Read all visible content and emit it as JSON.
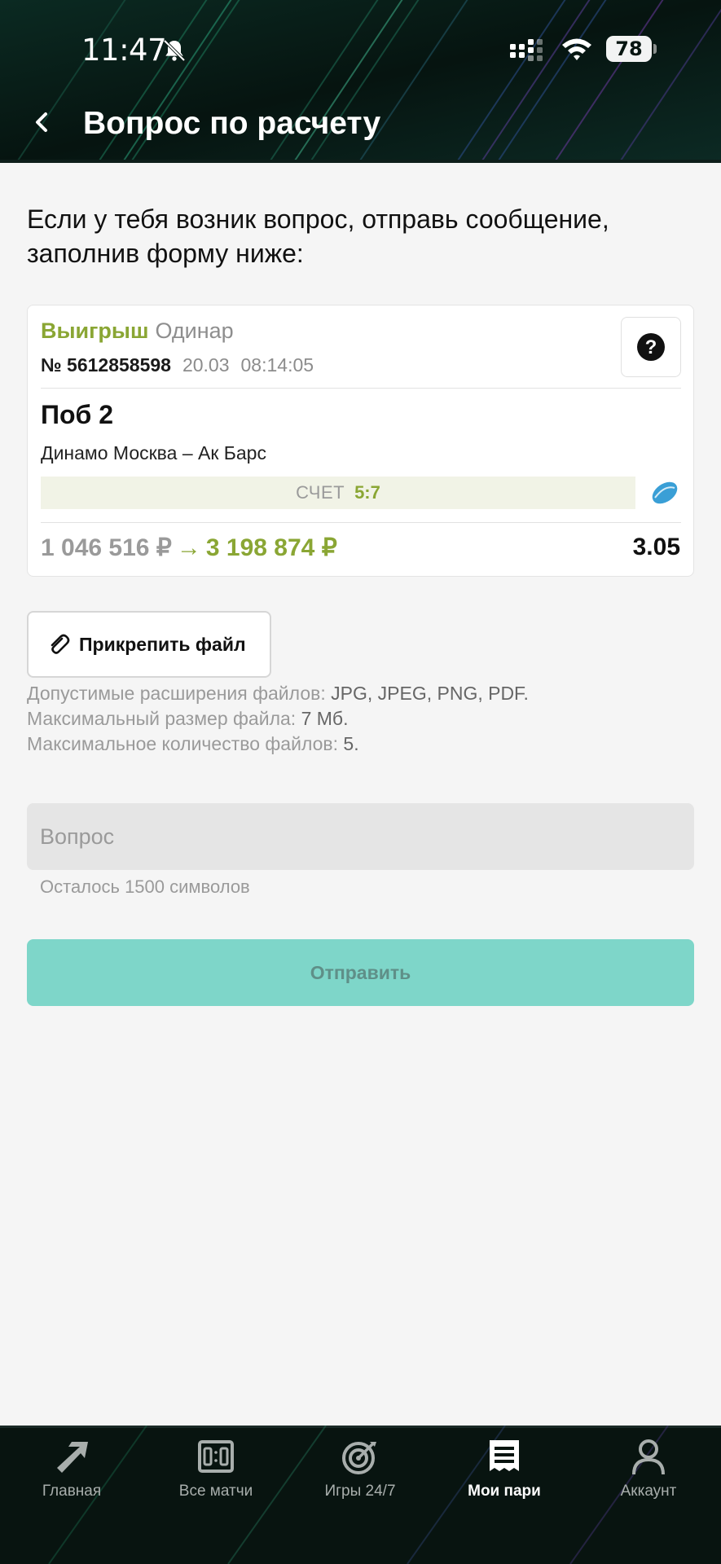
{
  "status_bar": {
    "time": "11:47",
    "battery": "78"
  },
  "header": {
    "title": "Вопрос по расчету"
  },
  "intro": "Если у тебя возник вопрос, отправь сообщение, заполнив форму ниже:",
  "bet": {
    "status": "Выигрыш",
    "type": "Одинар",
    "number": "№ 5612858598",
    "date": "20.03",
    "time": "08:14:05",
    "outcome": "Поб 2",
    "match": "Динамо Москва – Ак Барс",
    "score_label": "СЧЕТ",
    "score": "5:7",
    "stake": "1 046 516 ₽",
    "arrow": "→",
    "payout": "3 198 874 ₽",
    "odds": "3.05"
  },
  "attach": {
    "label": "Прикрепить файл"
  },
  "file_rules": {
    "ext_label": "Допустимые расширения файлов: ",
    "ext_value": "JPG, JPEG, PNG, PDF.",
    "size_label": "Максимальный размер файла: ",
    "size_value": "7 Мб.",
    "count_label": "Максимальное количество файлов: ",
    "count_value": "5."
  },
  "question": {
    "placeholder": "Вопрос",
    "value": "",
    "chars_left": "Осталось 1500 символов"
  },
  "submit": {
    "label": "Отправить"
  },
  "nav": {
    "items": [
      {
        "label": "Главная",
        "icon": "home-arrow-icon"
      },
      {
        "label": "Все матчи",
        "icon": "scoreboard-icon"
      },
      {
        "label": "Игры 24/7",
        "icon": "target-icon"
      },
      {
        "label": "Мои пари",
        "icon": "receipt-icon",
        "active": true
      },
      {
        "label": "Аккаунт",
        "icon": "user-icon"
      }
    ]
  },
  "colors": {
    "accent_green": "#8aa634",
    "submit_bg": "#7ed6c9",
    "header_bg": "#071511",
    "page_bg": "#f5f5f5"
  }
}
